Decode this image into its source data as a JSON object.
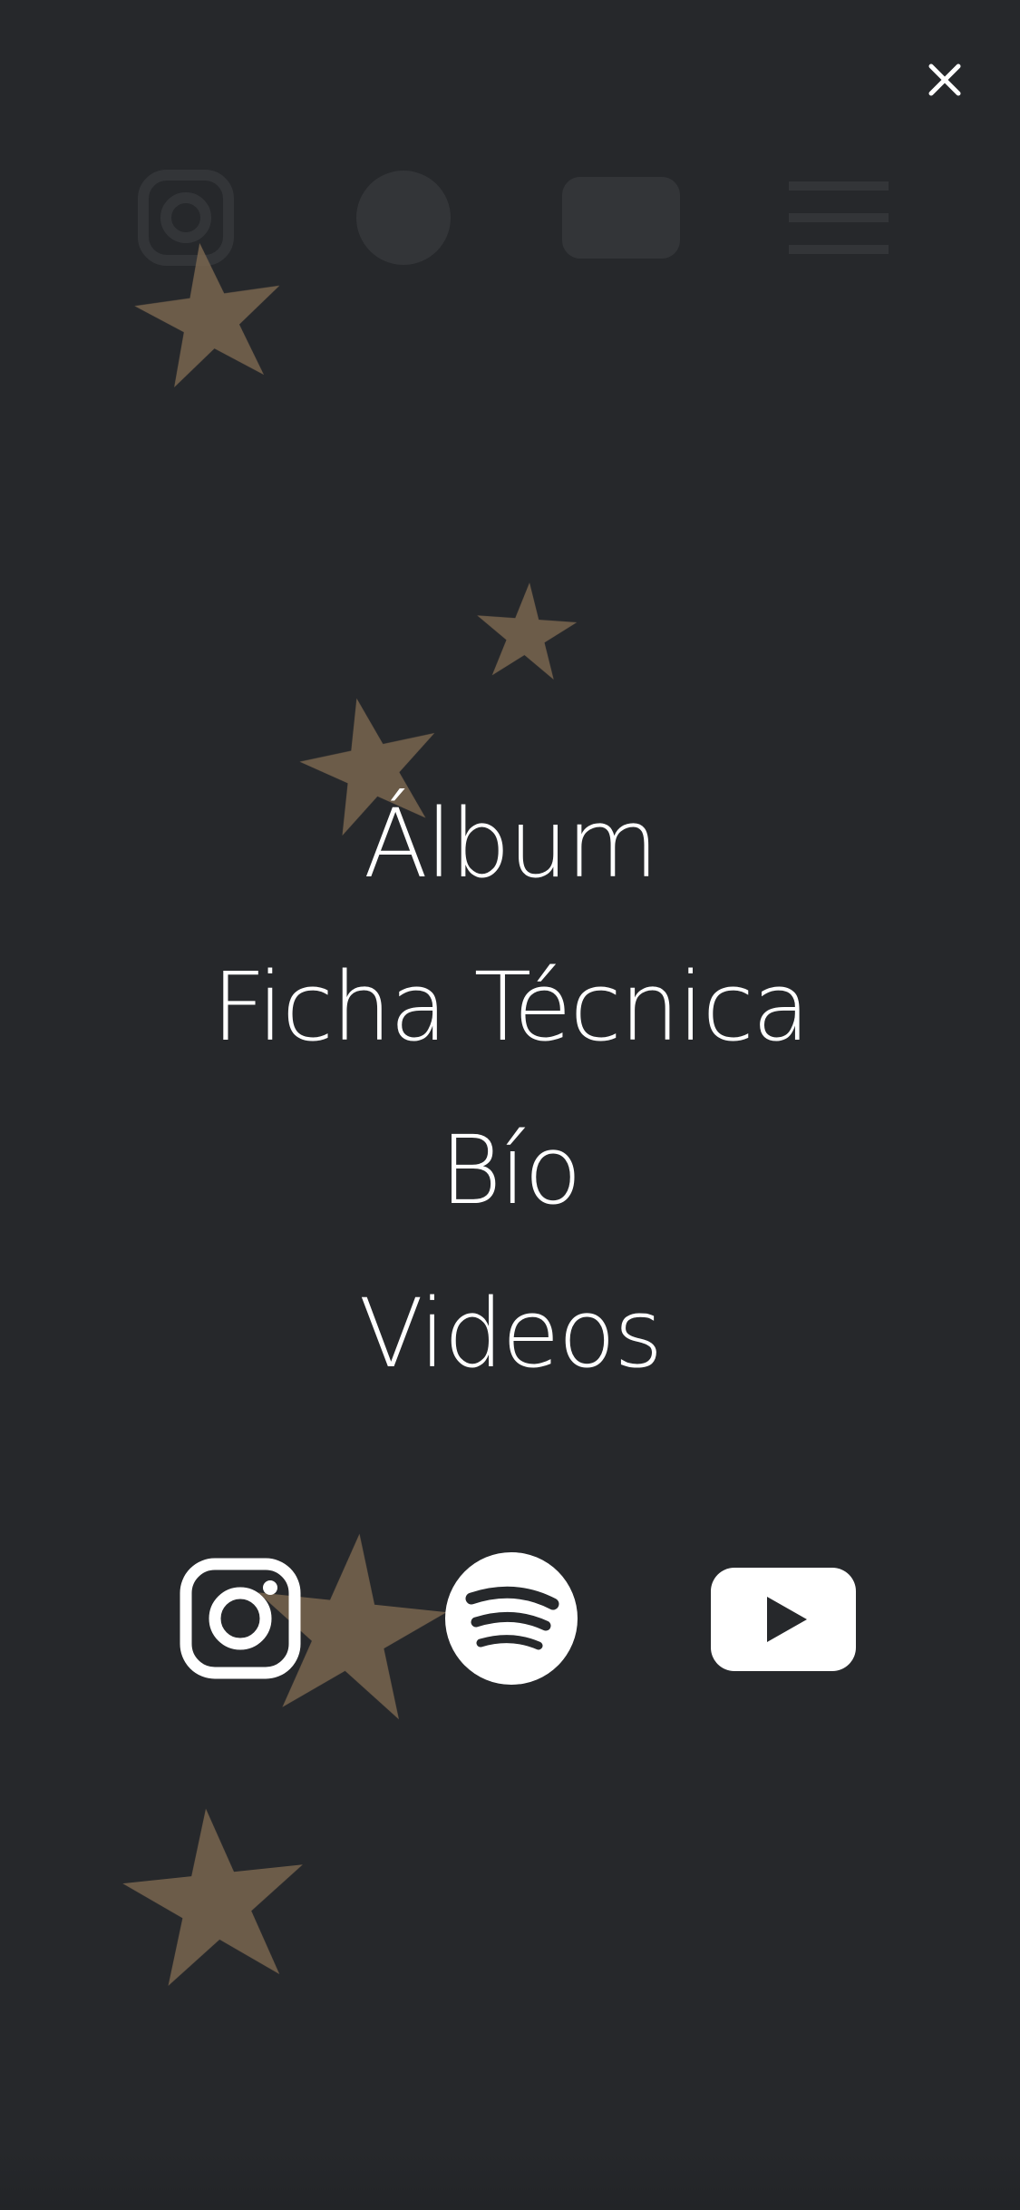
{
  "overlay": {
    "close_label": "✕"
  },
  "menu": {
    "items": [
      {
        "label": "Álbum"
      },
      {
        "label": "Ficha Técnica"
      },
      {
        "label": "Bío"
      },
      {
        "label": "Videos"
      }
    ]
  },
  "social": {
    "items": [
      {
        "icon": "instagram-icon"
      },
      {
        "icon": "spotify-icon"
      },
      {
        "icon": "youtube-icon"
      }
    ]
  },
  "colors": {
    "background": "#26282b",
    "text": "#ffffff",
    "star": "#7a6650"
  }
}
